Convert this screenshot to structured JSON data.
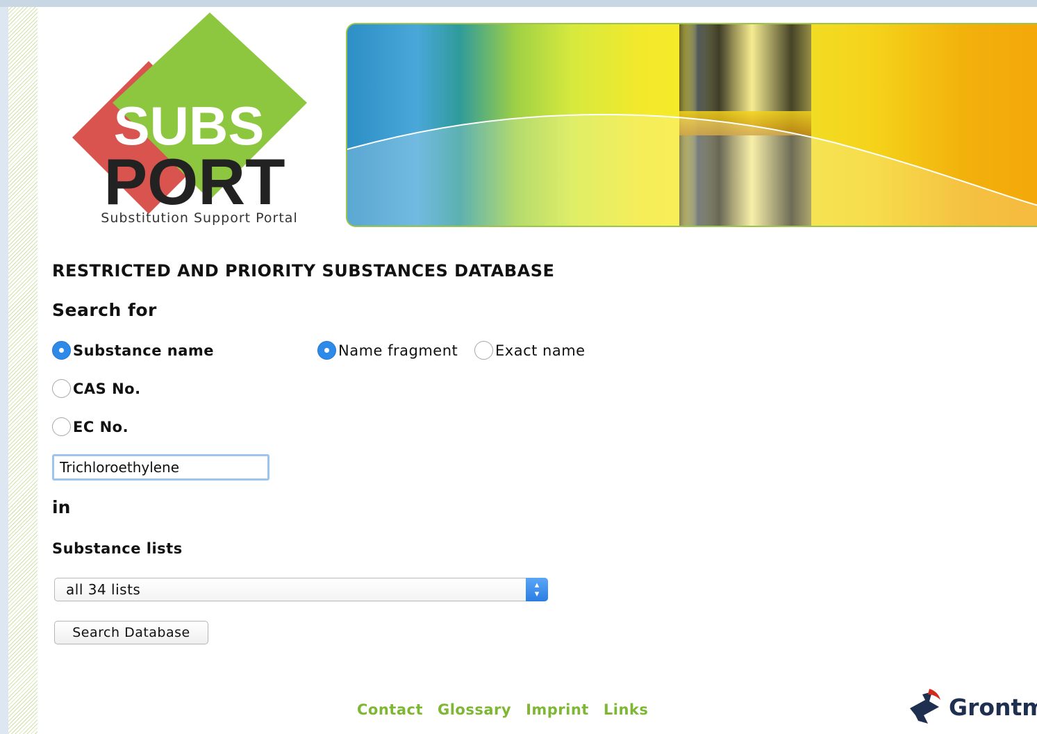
{
  "logo": {
    "word_top": "SUBS",
    "word_bottom": "PORT",
    "tagline": "Substitution Support Portal"
  },
  "db_title": "RESTRICTED AND PRIORITY SUBSTANCES DATABASE",
  "search_for": {
    "heading": "Search for",
    "options": [
      {
        "label": "Substance name",
        "selected": true
      },
      {
        "label": "CAS No.",
        "selected": false
      },
      {
        "label": "EC No.",
        "selected": false
      }
    ],
    "match_options": [
      {
        "label": "Name fragment",
        "selected": true
      },
      {
        "label": "Exact name",
        "selected": false
      }
    ],
    "input_value": "Trichloroethylene"
  },
  "in_label": "in",
  "lists": {
    "heading": "Substance lists",
    "selected": "all 34 lists"
  },
  "search_button": "Search Database",
  "footer": {
    "links": [
      "Contact",
      "Glossary",
      "Imprint",
      "Links"
    ],
    "partner": "Grontm"
  },
  "colors": {
    "accent_green": "#7db734",
    "logo_red": "#d9534f",
    "logo_green": "#8dc63f",
    "radio_blue": "#2e8ae8"
  }
}
